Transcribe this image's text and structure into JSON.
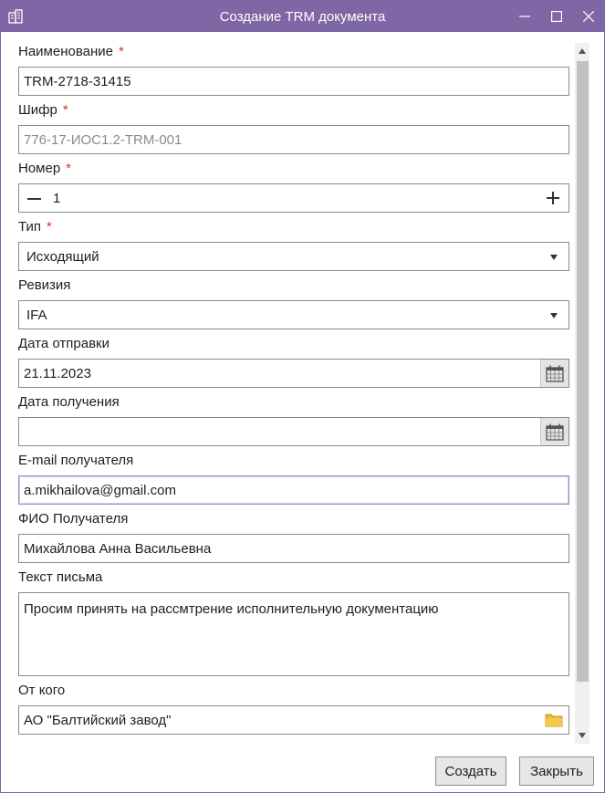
{
  "window": {
    "title": "Создание TRM документа",
    "accent": "#7f66a4"
  },
  "form": {
    "name": {
      "label": "Наименование",
      "required_mark": "*",
      "value": "TRM-2718-31415"
    },
    "cipher": {
      "label": "Шифр",
      "required_mark": "*",
      "placeholder": "776-17-ИОС1.2-TRM-001"
    },
    "number": {
      "label": "Номер",
      "required_mark": "*",
      "value": "1"
    },
    "type": {
      "label": "Тип",
      "required_mark": "*",
      "value": "Исходящий"
    },
    "revision": {
      "label": "Ревизия",
      "value": "IFA"
    },
    "send_date": {
      "label": "Дата отправки",
      "value": "21.11.2023"
    },
    "receive_date": {
      "label": "Дата получения",
      "value": ""
    },
    "email": {
      "label": "E-mail получателя",
      "value": "a.mikhailova@gmail.com"
    },
    "recipient": {
      "label": "ФИО Получателя",
      "value": "Михайлова Анна Васильевна"
    },
    "letter": {
      "label": "Текст письма",
      "value": "Просим принять на рассмтрение исполнительную документацию"
    },
    "from": {
      "label": "От кого",
      "value": "АО \"Балтийский завод\""
    }
  },
  "buttons": {
    "create": "Создать",
    "close": "Закрыть"
  }
}
